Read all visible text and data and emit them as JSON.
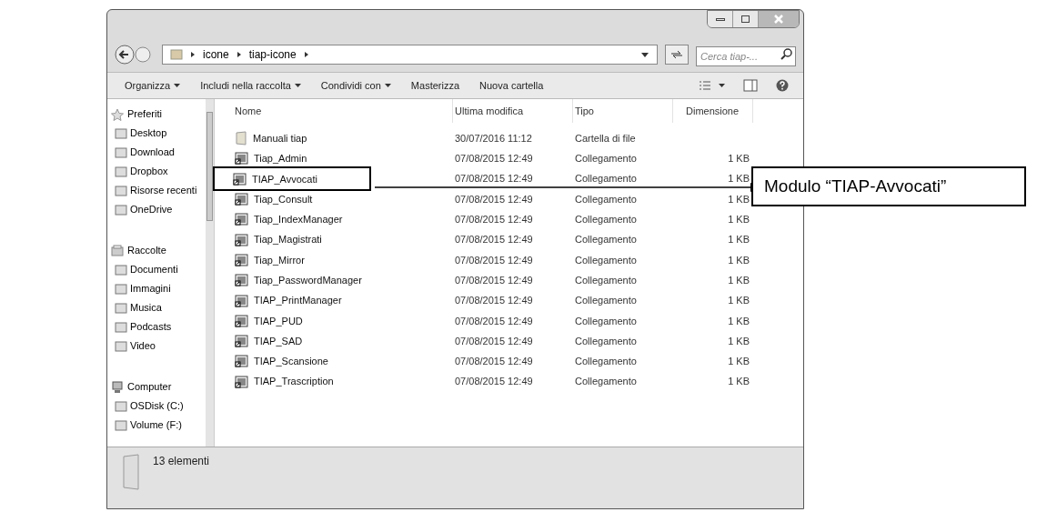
{
  "address_bar": {
    "breadcrumbs": [
      "icone",
      "tiap-icone"
    ]
  },
  "search": {
    "placeholder": "Cerca tiap-..."
  },
  "toolbar": [
    {
      "label": "Organizza",
      "dropdown": true
    },
    {
      "label": "Includi nella raccolta",
      "dropdown": true
    },
    {
      "label": "Condividi con",
      "dropdown": true
    },
    {
      "label": "Masterizza",
      "dropdown": false
    },
    {
      "label": "Nuova cartella",
      "dropdown": false
    }
  ],
  "sidebar": {
    "groups": [
      {
        "label": "Preferiti",
        "items": [
          "Desktop",
          "Download",
          "Dropbox",
          "Risorse recenti",
          "OneDrive"
        ]
      },
      {
        "label": "Raccolte",
        "items": [
          "Documenti",
          "Immagini",
          "Musica",
          "Podcasts",
          "Video"
        ]
      },
      {
        "label": "Computer",
        "items": [
          "OSDisk (C:)",
          "Volume (F:)"
        ]
      }
    ]
  },
  "table": {
    "columns": [
      "Nome",
      "Ultima modifica",
      "Tipo",
      "Dimensione"
    ],
    "rows": [
      {
        "kind": "folder",
        "name": "Manuali tiap",
        "modified": "30/07/2016 11:12",
        "type": "Cartella di file",
        "boxed": false
      },
      {
        "kind": "shortcut",
        "name": "Tiap_Admin",
        "modified": "07/08/2015 12:49",
        "type": "Collegamento",
        "size": "1 KB",
        "boxed": false
      },
      {
        "kind": "shortcut",
        "name": "TIAP_Avvocati",
        "modified": "07/08/2015 12:49",
        "type": "Collegamento",
        "size": "1 KB",
        "boxed": true
      },
      {
        "kind": "shortcut",
        "name": "Tiap_Consult",
        "modified": "07/08/2015 12:49",
        "type": "Collegamento",
        "size": "1 KB",
        "boxed": false
      },
      {
        "kind": "shortcut",
        "name": "Tiap_IndexManager",
        "modified": "07/08/2015 12:49",
        "type": "Collegamento",
        "size": "1 KB",
        "boxed": false
      },
      {
        "kind": "shortcut",
        "name": "Tiap_Magistrati",
        "modified": "07/08/2015 12:49",
        "type": "Collegamento",
        "size": "1 KB",
        "boxed": false
      },
      {
        "kind": "shortcut",
        "name": "Tiap_Mirror",
        "modified": "07/08/2015 12:49",
        "type": "Collegamento",
        "size": "1 KB",
        "boxed": false
      },
      {
        "kind": "shortcut",
        "name": "Tiap_PasswordManager",
        "modified": "07/08/2015 12:49",
        "type": "Collegamento",
        "size": "1 KB",
        "boxed": false
      },
      {
        "kind": "shortcut",
        "name": "TIAP_PrintManager",
        "modified": "07/08/2015 12:49",
        "type": "Collegamento",
        "size": "1 KB",
        "boxed": false
      },
      {
        "kind": "shortcut",
        "name": "TIAP_PUD",
        "modified": "07/08/2015 12:49",
        "type": "Collegamento",
        "size": "1 KB",
        "boxed": false
      },
      {
        "kind": "shortcut",
        "name": "TIAP_SAD",
        "modified": "07/08/2015 12:49",
        "type": "Collegamento",
        "size": "1 KB",
        "boxed": false
      },
      {
        "kind": "shortcut",
        "name": "TIAP_Scansione",
        "modified": "07/08/2015 12:49",
        "type": "Collegamento",
        "size": "1 KB",
        "boxed": false
      },
      {
        "kind": "shortcut",
        "name": "TIAP_Trascription",
        "modified": "07/08/2015 12:49",
        "type": "Collegamento",
        "size": "1 KB",
        "boxed": false
      }
    ]
  },
  "status_bar": {
    "text": "13 elementi"
  },
  "callout": {
    "text": "Modulo “TIAP-Avvocati”"
  }
}
